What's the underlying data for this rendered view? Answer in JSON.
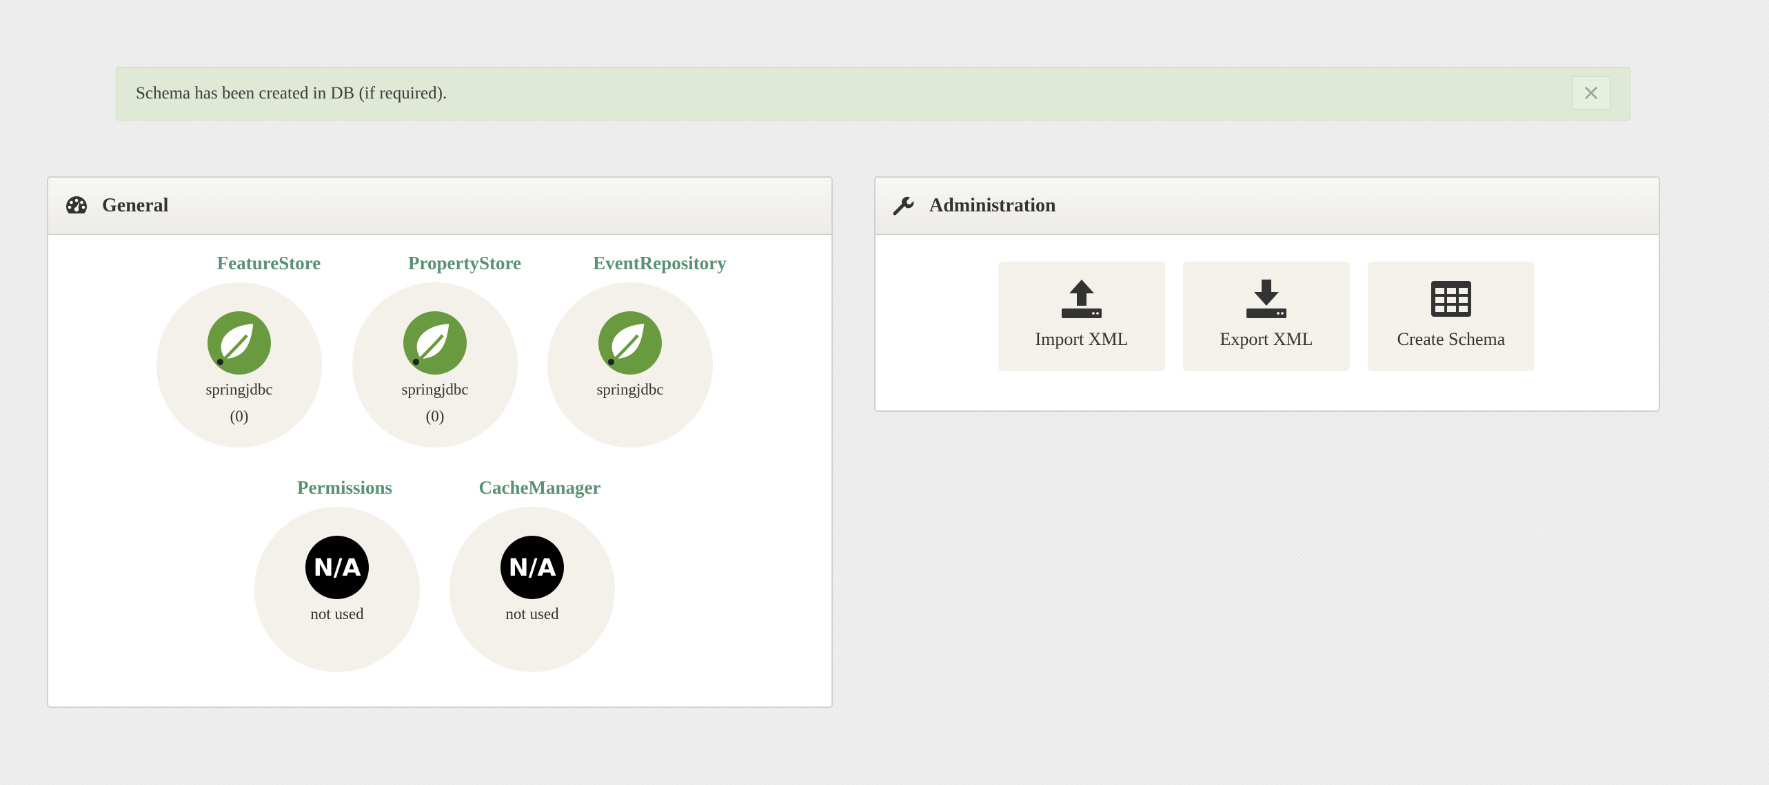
{
  "alert": {
    "message": "Schema has been created in DB (if required).",
    "close_label": "×"
  },
  "general": {
    "title": "General",
    "icon": "dashboard-icon",
    "stores": [
      {
        "title": "FeatureStore",
        "name": "springjdbc",
        "count": "(0)",
        "icon": "spring-leaf-icon"
      },
      {
        "title": "PropertyStore",
        "name": "springjdbc",
        "count": "(0)",
        "icon": "spring-leaf-icon"
      },
      {
        "title": "EventRepository",
        "name": "springjdbc",
        "icon": "spring-leaf-icon"
      },
      {
        "title": "Permissions",
        "name": "not used",
        "icon": "na-icon",
        "badge": "N/A"
      },
      {
        "title": "CacheManager",
        "name": "not used",
        "icon": "na-icon",
        "badge": "N/A"
      }
    ]
  },
  "administration": {
    "title": "Administration",
    "icon": "wrench-icon",
    "actions": [
      {
        "label": "Import XML",
        "icon": "upload-icon"
      },
      {
        "label": "Export XML",
        "icon": "download-icon"
      },
      {
        "label": "Create Schema",
        "icon": "table-icon"
      }
    ]
  },
  "colors": {
    "accent": "#5a9173",
    "spring_green": "#6a9a3f",
    "alert_bg": "#dfe9d6",
    "circle_bg": "#f3f1ea"
  }
}
